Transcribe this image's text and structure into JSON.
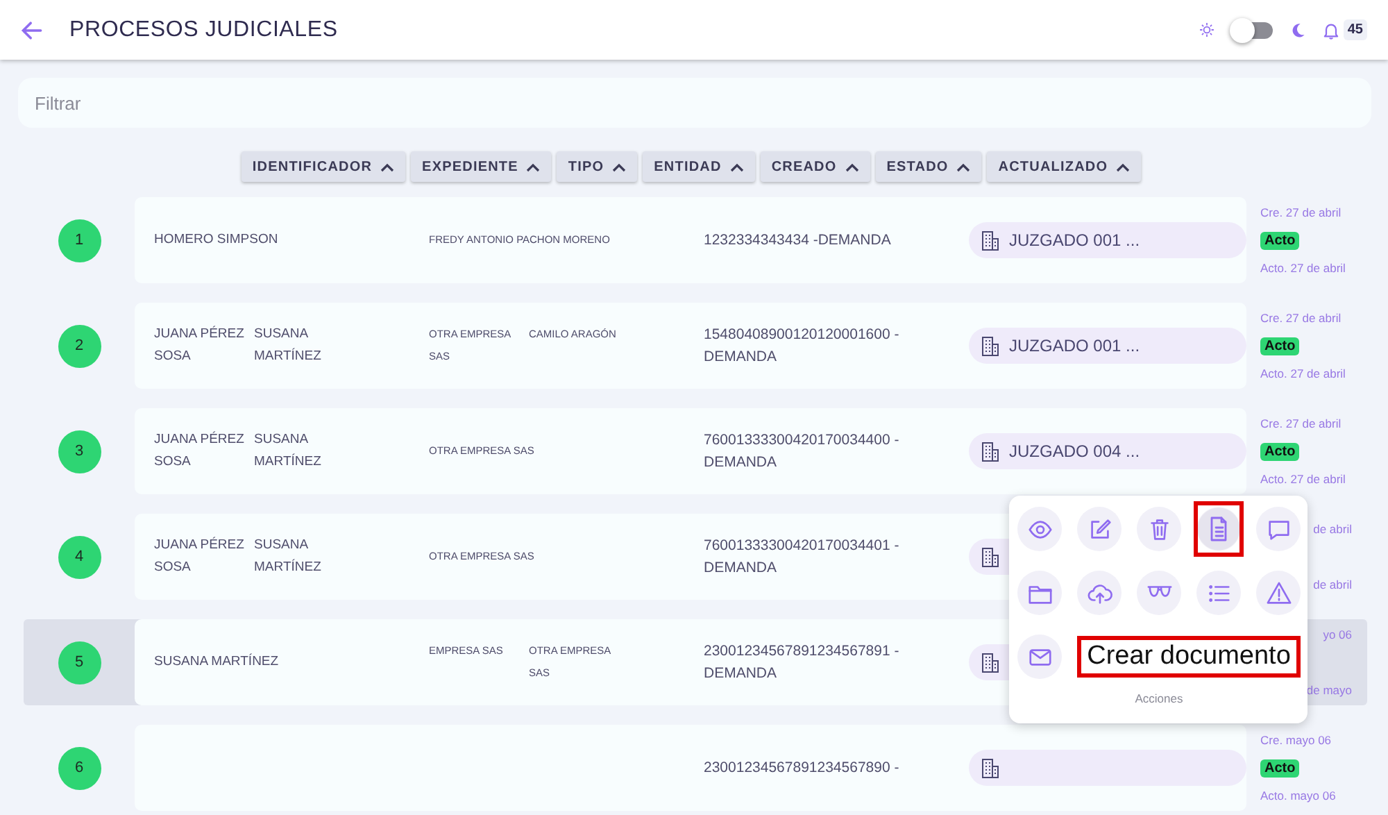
{
  "header": {
    "title": "PROCESOS JUDICIALES",
    "dark_mode": false,
    "notifications": "45"
  },
  "filter": {
    "placeholder": "Filtrar"
  },
  "sort_columns": [
    "IDENTIFICADOR",
    "EXPEDIENTE",
    "TIPO",
    "ENTIDAD",
    "CREADO",
    "ESTADO",
    "ACTUALIZADO"
  ],
  "rows": [
    {
      "number": "1",
      "selected": false,
      "partly_covered": false,
      "names": [
        "HOMERO SIMPSON"
      ],
      "entities": [
        "FREDY ANTONIO PACHON MORENO"
      ],
      "case": "1232334343434 -DEMANDA",
      "court": "JUZGADO 001 ...",
      "created": "Cre. 27 de abril",
      "status": "Acto",
      "updated": "Acto. 27 de abril"
    },
    {
      "number": "2",
      "selected": false,
      "partly_covered": false,
      "names": [
        "JUANA PÉREZ SOSA",
        "SUSANA MARTÍNEZ"
      ],
      "entities": [
        "OTRA EMPRESA SAS",
        "CAMILO ARAGÓN"
      ],
      "case": "15480408900120120001600 - DEMANDA",
      "court": "JUZGADO 001 ...",
      "created": "Cre. 27 de abril",
      "status": "Acto",
      "updated": "Acto. 27 de abril"
    },
    {
      "number": "3",
      "selected": false,
      "partly_covered": false,
      "names": [
        "JUANA PÉREZ SOSA",
        "SUSANA MARTÍNEZ"
      ],
      "entities": [
        "OTRA EMPRESA SAS"
      ],
      "case": "76001333300420170034400 - DEMANDA",
      "court": "JUZGADO 004 ...",
      "created": "Cre. 27 de abril",
      "status": "Acto",
      "updated": "Acto. 27 de abril"
    },
    {
      "number": "4",
      "selected": false,
      "partly_covered": true,
      "names": [
        "JUANA PÉREZ SOSA",
        "SUSANA MARTÍNEZ"
      ],
      "entities": [
        "OTRA EMPRESA SAS"
      ],
      "case": "76001333300420170034401 - DEMANDA",
      "created": "de abril",
      "updated": "de abril"
    },
    {
      "number": "5",
      "selected": true,
      "partly_covered": true,
      "names": [
        "SUSANA MARTÍNEZ"
      ],
      "entities": [
        "EMPRESA SAS",
        "OTRA EMPRESA SAS"
      ],
      "case": "23001234567891234567891 - DEMANDA",
      "created": "yo 06",
      "updated": "de mayo"
    },
    {
      "number": "6",
      "selected": false,
      "partly_covered": false,
      "names": [],
      "entities": [],
      "case": "23001234567891234567890 -",
      "created": "Cre. mayo 06",
      "status": "Acto",
      "updated": "Acto. mayo 06"
    }
  ],
  "actions_menu": {
    "actions": [
      {
        "kind": "eye",
        "highlighted": false
      },
      {
        "kind": "edit",
        "highlighted": false
      },
      {
        "kind": "trash",
        "highlighted": false
      },
      {
        "kind": "document",
        "highlighted": true
      },
      {
        "kind": "chat",
        "highlighted": false
      },
      {
        "kind": "folder",
        "highlighted": false
      },
      {
        "kind": "upload",
        "highlighted": false
      },
      {
        "kind": "glasses",
        "highlighted": false
      },
      {
        "kind": "list",
        "highlighted": false
      },
      {
        "kind": "warning",
        "highlighted": false
      },
      {
        "kind": "mail",
        "highlighted": false
      }
    ],
    "tooltip": "Crear documento",
    "caption": "Acciones"
  }
}
